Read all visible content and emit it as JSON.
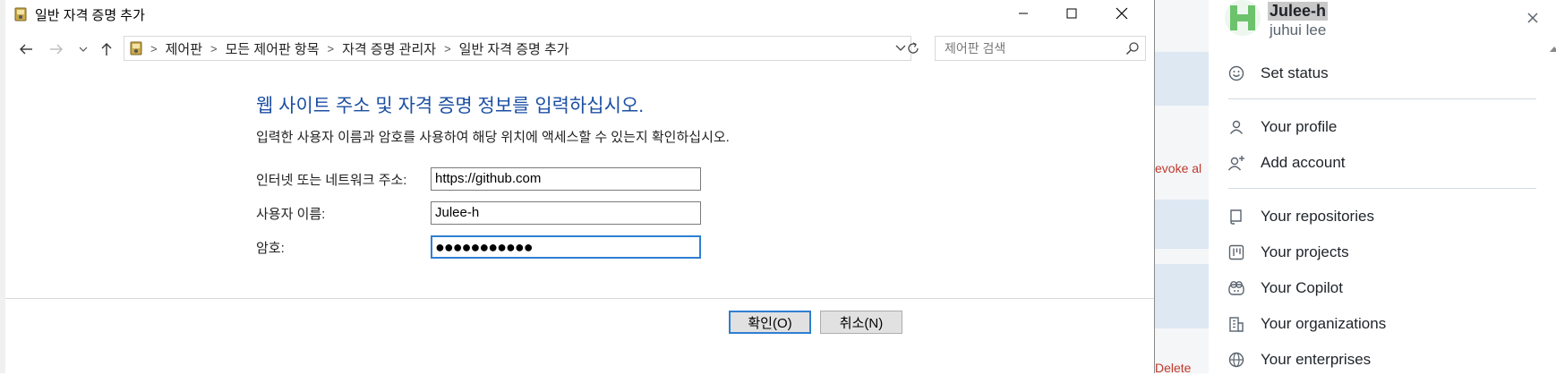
{
  "dialog": {
    "title": "일반 자격 증명 추가",
    "breadcrumbs": [
      "제어판",
      "모든 제어판 항목",
      "자격 증명 관리자",
      "일반 자격 증명 추가"
    ],
    "search_placeholder": "제어판 검색",
    "heading": "웹 사이트 주소 및 자격 증명 정보를 입력하십시오.",
    "subheading": "입력한 사용자 이름과 암호를 사용하여 해당 위치에 액세스할 수 있는지 확인하십시오.",
    "fields": {
      "address_label": "인터넷 또는 네트워크 주소:",
      "address_value": "https://github.com",
      "username_label": "사용자 이름:",
      "username_value": "Julee-h",
      "password_label": "암호:",
      "password_mask": "●●●●●●●●●●●"
    },
    "ok_label": "확인(O)",
    "cancel_label": "취소(N)"
  },
  "background": {
    "revoke_text": "evoke al",
    "delete_text": "Delete"
  },
  "user_menu": {
    "username": "Julee-h",
    "full_name": "juhui lee",
    "items": [
      {
        "label": "Set status",
        "icon": "smiley-icon"
      },
      {
        "label": "Your profile",
        "icon": "person-icon"
      },
      {
        "label": "Add account",
        "icon": "person-add-icon"
      },
      {
        "label": "Your repositories",
        "icon": "repo-icon"
      },
      {
        "label": "Your projects",
        "icon": "project-icon"
      },
      {
        "label": "Your Copilot",
        "icon": "copilot-icon"
      },
      {
        "label": "Your organizations",
        "icon": "organization-icon"
      },
      {
        "label": "Your enterprises",
        "icon": "globe-icon"
      }
    ]
  },
  "colors": {
    "heading": "#1c4fa3",
    "focus_border": "#2f7fd1",
    "revoke_red": "#c0392b"
  }
}
